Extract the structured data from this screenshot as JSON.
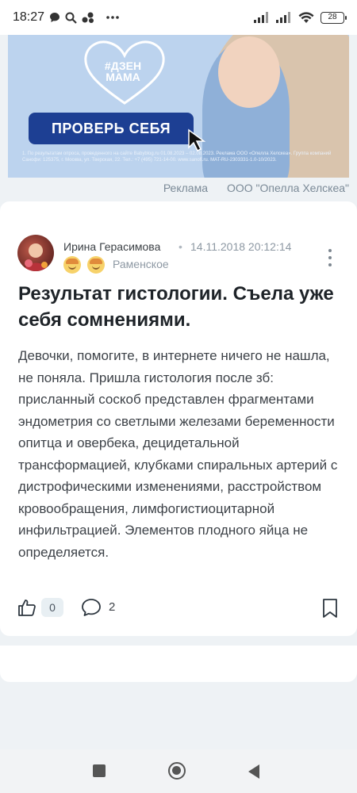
{
  "status_bar": {
    "time": "18:27",
    "battery": "28",
    "icons": [
      "chat-bubble-icon",
      "search-icon",
      "apps-icon",
      "more-dots-icon",
      "signal-icon",
      "signal-icon",
      "wifi-icon",
      "battery-icon"
    ]
  },
  "ad": {
    "heart_text_line1": "#ДЗЕН",
    "heart_text_line2": "МАМА",
    "cta_label": "ПРОВЕРЬ СЕБЯ",
    "disclaimer": "1. По результатам опроса, проведенного на сайте Babyblog.ru 01.08.2023 – 02.08.2023. Реклама ООО «Опелла Хелскеа». Группа компаний Санофи: 125375, г. Москва, ул. Тверская, 22. Тел.: +7 (495) 721-14-00. www.sanofi.ru. MAT-RU-2303331-1.0-10/2023.",
    "label": "Реклама",
    "advertiser": "ООО \"Опелла Хелскеа\""
  },
  "post": {
    "author": "Ирина Герасимова",
    "separator": "•",
    "date": "14.11.2018 20:12:14",
    "city": "Раменское",
    "title": "Результат гистологии. Съела уже себя сомнениями.",
    "body": "Девочки, помогите, в интернете ничего не нашла, не поняла. Пришла гистология после зб: присланный соскоб представлен фрагментами эндометрия со светлыми железами беременности опитца и овербека, децидетальной трансформацией, клубками спиральных артерий с дистрофическими изменениями, расстройством кровообращения, лимфогистиоцитарной инфильтрацией. Элементов плодного яйца не определяется.",
    "likes": "0",
    "comments": "2"
  },
  "colors": {
    "accent": "#1d3f93",
    "page_bg": "#eef2f5",
    "card_bg": "#ffffff",
    "muted_text": "#8d98a3"
  }
}
